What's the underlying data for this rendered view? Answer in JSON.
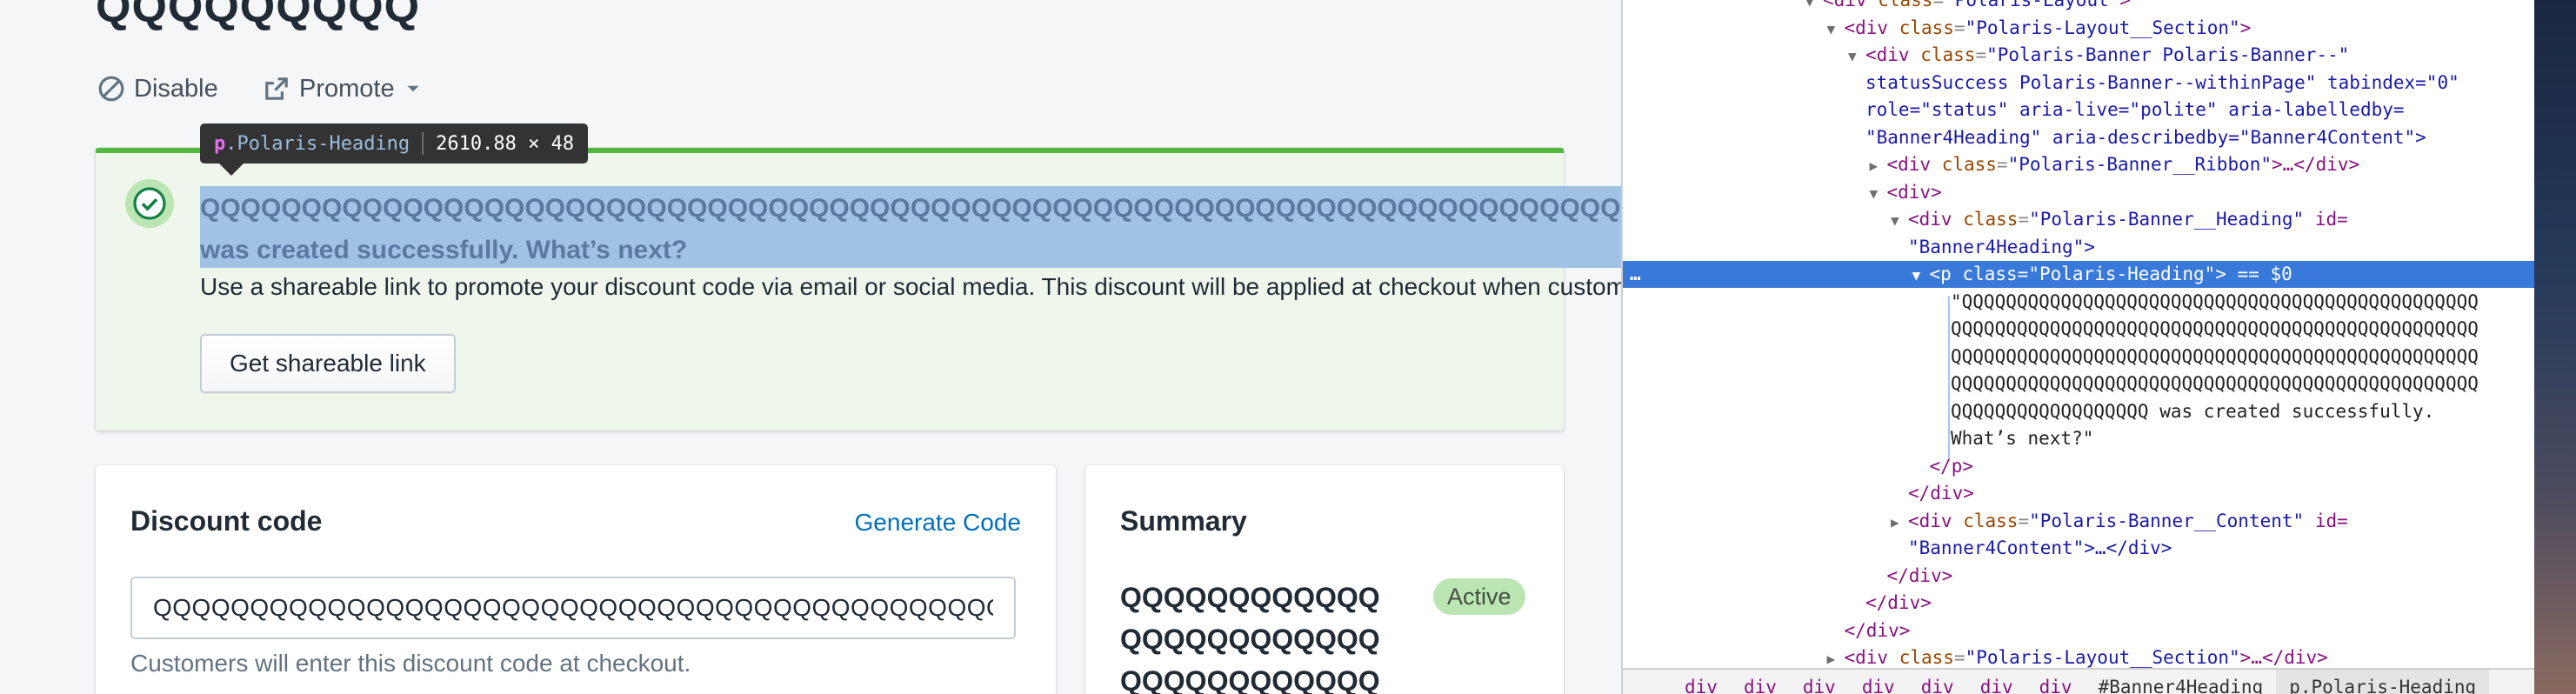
{
  "page": {
    "title": "QQQQQQQQQ",
    "actions": [
      {
        "label": "Disable",
        "icon": "disable-icon"
      },
      {
        "label": "Promote",
        "icon": "external-link-icon"
      }
    ]
  },
  "tooltip": {
    "tag": "p",
    "class_name": ".Polaris-Heading",
    "dimensions": "2610.88 × 48"
  },
  "banner": {
    "status": "success",
    "heading": "QQQQQQQQQQQQQQQQQQQQQQQQQQQQQQQQQQQQQQQQQQQQQQQQQQQQQQQQQQQQQQQQQQQQQQQQQQQQQQQQQQQQQQQQQQQQQQQQQQQQQQQQQQQQQQQQQQQQQQQQQQQQQQQQQQQQQQQQQQQQQQQQQQQQ\nwas created successfully. What’s next?",
    "content": "Use a shareable link to promote your discount code via email or social media. This discount will be applied at checkout when customers use this link.",
    "button_label": "Get shareable link"
  },
  "discount_card": {
    "title": "Discount code",
    "generate_label": "Generate Code",
    "code_value": "QQQQQQQQQQQQQQQQQQQQQQQQQQQQQQQQQQQQQQQQQQQQQQQQQQQQQQQQQQQQQQQQQQQQQQQQQQQQQQQQQ",
    "help_text": "Customers will enter this discount code at checkout."
  },
  "summary_card": {
    "title": "Summary",
    "code": "QQQQQQQQQQQQ QQQQQQQQQQQQ QQQQQQQQQQQQ",
    "badge": "Active"
  },
  "devtools": {
    "lines": [
      {
        "indent": 8,
        "tri": "▼",
        "open_tag": "div",
        "attrs": [
          {
            "name": "class",
            "value": "Polaris-Layout"
          }
        ],
        "suffix": ">"
      },
      {
        "indent": 9,
        "tri": "▼",
        "open_tag": "div",
        "attrs": [
          {
            "name": "class",
            "value": "Polaris-Layout__Section"
          }
        ],
        "suffix": ">"
      },
      {
        "indent": 10,
        "tri": "▼",
        "open_tag": "div",
        "attrs": [
          {
            "name": "class",
            "value": "Polaris-Banner Polaris-Banner--"
          }
        ],
        "suffix": ""
      },
      {
        "indent": 10,
        "tri": "",
        "raw": "statusSuccess Polaris-Banner--withinPage\" tabindex=\"0\""
      },
      {
        "indent": 10,
        "tri": "",
        "raw": "role=\"status\" aria-live=\"polite\" aria-labelledby="
      },
      {
        "indent": 10,
        "tri": "",
        "raw": "\"Banner4Heading\" aria-describedby=\"Banner4Content\">"
      },
      {
        "indent": 11,
        "tri": "▶",
        "open_tag": "div",
        "attrs": [
          {
            "name": "class",
            "value": "Polaris-Banner__Ribbon"
          }
        ],
        "suffix": ">…</div>"
      },
      {
        "indent": 11,
        "tri": "▼",
        "open_tag": "div",
        "attrs": [],
        "suffix": ">"
      },
      {
        "indent": 12,
        "tri": "▼",
        "open_tag": "div",
        "attrs": [
          {
            "name": "class",
            "value": "Polaris-Banner__Heading"
          }
        ],
        "suffix": " id="
      },
      {
        "indent": 12,
        "tri": "",
        "raw": "\"Banner4Heading\">"
      },
      {
        "indent": 13,
        "tri": "▼",
        "open_tag": "p",
        "attrs": [
          {
            "name": "class",
            "value": "Polaris-Heading"
          }
        ],
        "suffix": "> == $0",
        "selected": true
      },
      {
        "indent": 14,
        "tri": "",
        "raw": "\"QQQQQQQQQQQQQQQQQQQQQQQQQQQQQQQQQQQQQQQQQQQQQQQ"
      },
      {
        "indent": 14,
        "tri": "",
        "raw": "QQQQQQQQQQQQQQQQQQQQQQQQQQQQQQQQQQQQQQQQQQQQQQQQ"
      },
      {
        "indent": 14,
        "tri": "",
        "raw": "QQQQQQQQQQQQQQQQQQQQQQQQQQQQQQQQQQQQQQQQQQQQQQQQ"
      },
      {
        "indent": 14,
        "tri": "",
        "raw": "QQQQQQQQQQQQQQQQQQQQQQQQQQQQQQQQQQQQQQQQQQQQQQQQ"
      },
      {
        "indent": 14,
        "tri": "",
        "raw": "QQQQQQQQQQQQQQQQQQ was created successfully."
      },
      {
        "indent": 14,
        "tri": "",
        "raw": "What’s next?\""
      },
      {
        "indent": 13,
        "tri": "",
        "raw": "</p>"
      },
      {
        "indent": 12,
        "tri": "",
        "raw": "</div>"
      },
      {
        "indent": 12,
        "tri": "▶",
        "open_tag": "div",
        "attrs": [
          {
            "name": "class",
            "value": "Polaris-Banner__Content"
          }
        ],
        "suffix": " id="
      },
      {
        "indent": 12,
        "tri": "",
        "raw": "\"Banner4Content\">…</div>"
      },
      {
        "indent": 11,
        "tri": "",
        "raw": "</div>"
      },
      {
        "indent": 10,
        "tri": "",
        "raw": "</div>"
      },
      {
        "indent": 9,
        "tri": "",
        "raw": "</div>"
      },
      {
        "indent": 9,
        "tri": "▶",
        "open_tag": "div",
        "attrs": [
          {
            "name": "class",
            "value": "Polaris-Layout__Section"
          }
        ],
        "suffix": ">…</div>"
      }
    ],
    "breadcrumbs": [
      "div",
      "div",
      "div",
      "div",
      "div",
      "div",
      "div",
      "#Banner4Heading",
      "p.Polaris-Heading"
    ],
    "dots": "…"
  }
}
